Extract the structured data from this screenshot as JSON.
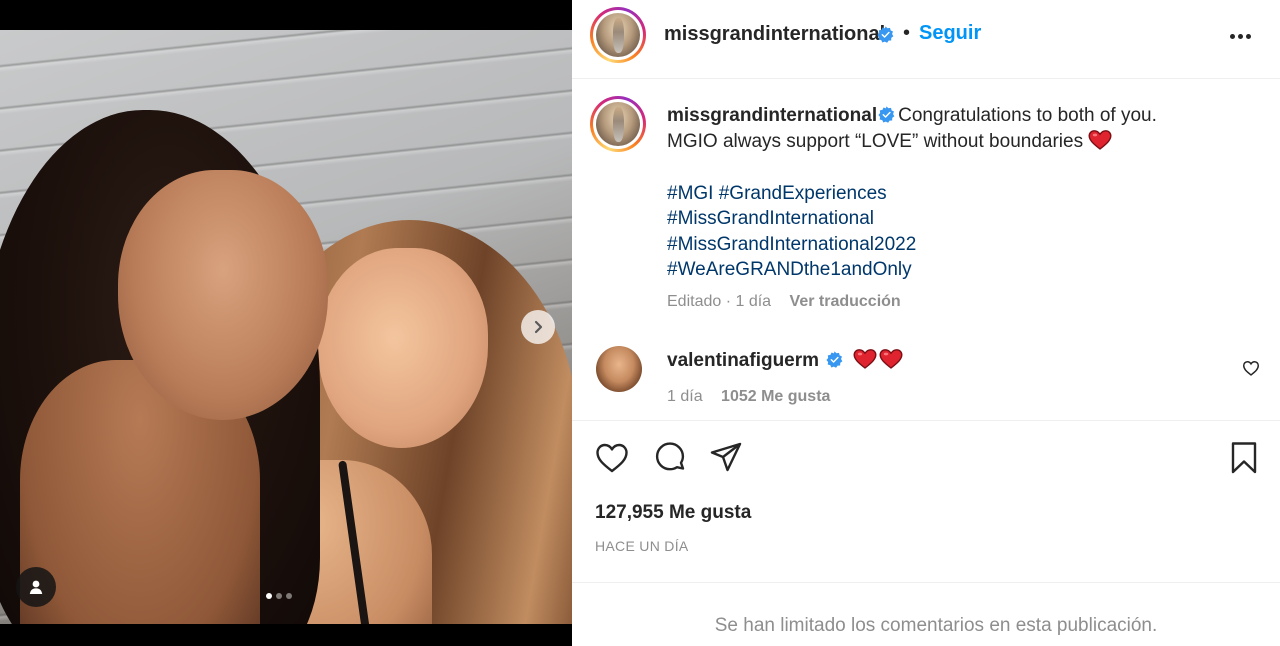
{
  "post": {
    "media": {
      "carousel": {
        "total": 3,
        "current": 1
      },
      "icons": {
        "next": "chevron-right-icon",
        "tagged_users": "user-icon"
      }
    },
    "header": {
      "username": "missgrandinternational",
      "separator": "•",
      "follow_label": "Seguir",
      "icons": {
        "verified": "verified-badge-icon",
        "more": "more-options-icon"
      }
    },
    "caption": {
      "username": "missgrandinternational",
      "text_line1": "Congratulations to both of you.",
      "text_line2": "MGIO always support “LOVE” without boundaries",
      "emoji": "red-heart",
      "hashtags": [
        "#MGI #GrandExperiences",
        "#MissGrandInternational",
        "#MissGrandInternational2022",
        "#WeAreGRANDthe1andOnly"
      ],
      "edited": "Editado · 1 día",
      "translate_label": "Ver traducción"
    },
    "comment": {
      "username": "valentinafiguerm",
      "emojis": [
        "red-heart",
        "red-heart"
      ],
      "time": "1 día",
      "likes": "1052 Me gusta"
    },
    "actions": {
      "icons": [
        "heart-icon",
        "comment-icon",
        "share-icon",
        "bookmark-icon"
      ]
    },
    "likes_count": "127,955 Me gusta",
    "timestamp": "HACE UN DÍA",
    "comments_limited": "Se han limitado los comentarios en esta publicación.",
    "colors": {
      "link_blue": "#0095f6",
      "hashtag_blue": "#00376b",
      "verified_blue": "#3897f0",
      "text_primary": "#262626",
      "text_secondary": "#8e8e8e",
      "heart_red": "#ed4956"
    }
  }
}
